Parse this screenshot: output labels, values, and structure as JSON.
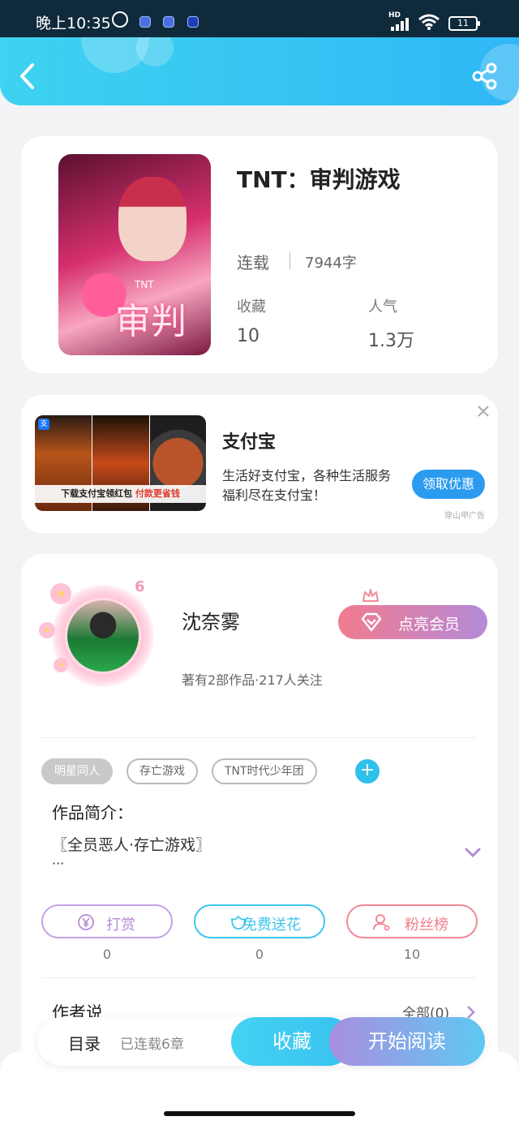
{
  "status_bar": {
    "time": "晚上10:35",
    "network": "HD",
    "battery": "11"
  },
  "book": {
    "title": "TNT：审判游戏",
    "status": "连载",
    "word_count": "7944字",
    "favorites_label": "收藏",
    "favorites_value": "10",
    "popularity_label": "人气",
    "popularity_value": "1.3万",
    "cover_title": "审判",
    "cover_subtitle": "TNT"
  },
  "ad": {
    "title": "支付宝",
    "description": "生活好支付宝，各种生活服务福利尽在支付宝！",
    "button": "领取优惠",
    "source": "穿山甲广告",
    "banner_text": "下载支付宝领红包",
    "banner_highlight": "付款更省钱",
    "app_tag": "支"
  },
  "author": {
    "level": "6",
    "name": "沈奈雾",
    "stats": "著有2部作品·217人关注",
    "vip_button": "点亮会员"
  },
  "tags": [
    "明星同人",
    "存亡游戏",
    "TNT时代少年团"
  ],
  "intro": {
    "label": "作品简介：",
    "text": "〖全员恶人·存亡游戏〗",
    "ellipsis": "···"
  },
  "actions": {
    "reward": {
      "label": "打赏",
      "count": "0",
      "color": "#b48ad9"
    },
    "flower": {
      "label": "免费送花",
      "count": "0",
      "color": "#3cc6ee"
    },
    "fans": {
      "label": "粉丝榜",
      "count": "10",
      "color": "#ef7f8a"
    }
  },
  "author_say": {
    "label": "作者说",
    "all": "全部(0)"
  },
  "bottom_bar": {
    "toc": "目录",
    "chapters": "已连载6章",
    "favorite": "收藏",
    "start_reading": "开始阅读"
  },
  "colors": {
    "header_start": "#3ed3f0",
    "header_end": "#2fb7f5",
    "accent": "#2fc0ec"
  }
}
